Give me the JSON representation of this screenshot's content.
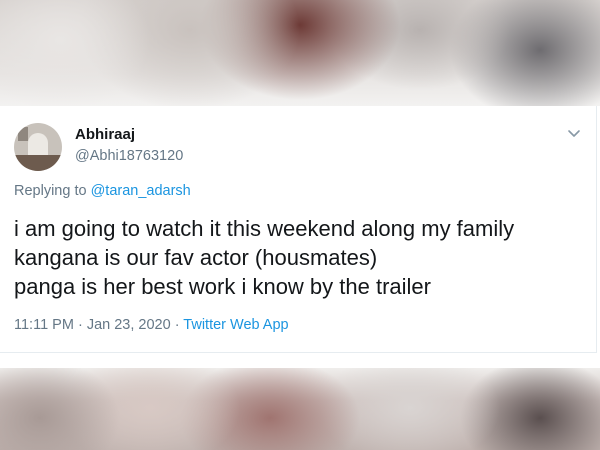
{
  "tweet": {
    "display_name": "Abhiraaj",
    "handle": "@Abhi18763120",
    "replying_prefix": "Replying to",
    "replying_to": "@taran_adarsh",
    "lines": [
      "i am going to watch it this weekend along my family",
      "kangana is our fav actor (housmates)",
      "panga is her best work i know by the trailer"
    ],
    "time": "11:11 PM",
    "separator1": " · ",
    "date": "Jan 23, 2020",
    "separator2": " · ",
    "source": "Twitter Web App"
  },
  "icons": {
    "avatar": "user-avatar",
    "caret": "chevron-down-icon"
  },
  "colors": {
    "text": "#14171a",
    "secondary": "#657786",
    "link": "#1b95e0",
    "border": "#e6ecf0"
  }
}
